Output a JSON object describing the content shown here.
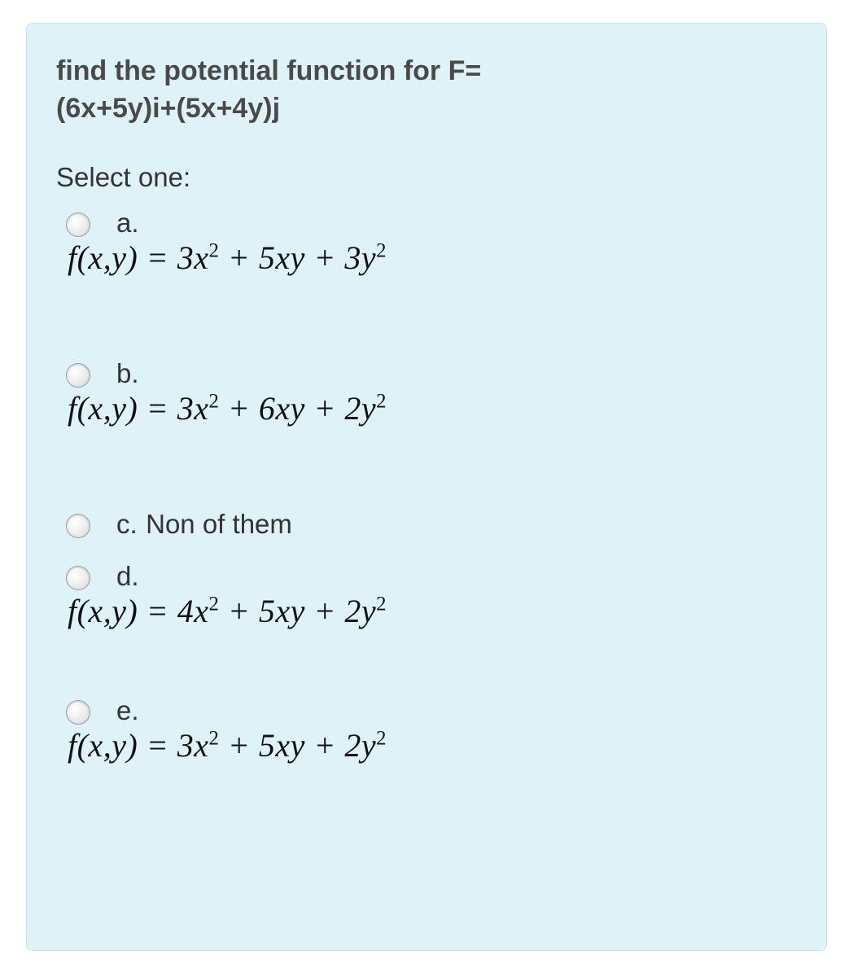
{
  "question": {
    "line1": "find the potential function for F=",
    "line2": "(6x+5y)i+(5x+4y)j"
  },
  "prompt": "Select one:",
  "options": {
    "a": {
      "label": "a.",
      "formula": "f(x,y) = 3x² + 5xy + 3y²"
    },
    "b": {
      "label": "b.",
      "formula": "f(x,y) = 3x² + 6xy + 2y²"
    },
    "c": {
      "label": "c.",
      "text": "Non of them"
    },
    "d": {
      "label": "d.",
      "formula": "f(x,y) = 4x² + 5xy + 2y²"
    },
    "e": {
      "label": "e.",
      "formula": "f(x,y) = 3x² + 5xy + 2y²"
    }
  }
}
